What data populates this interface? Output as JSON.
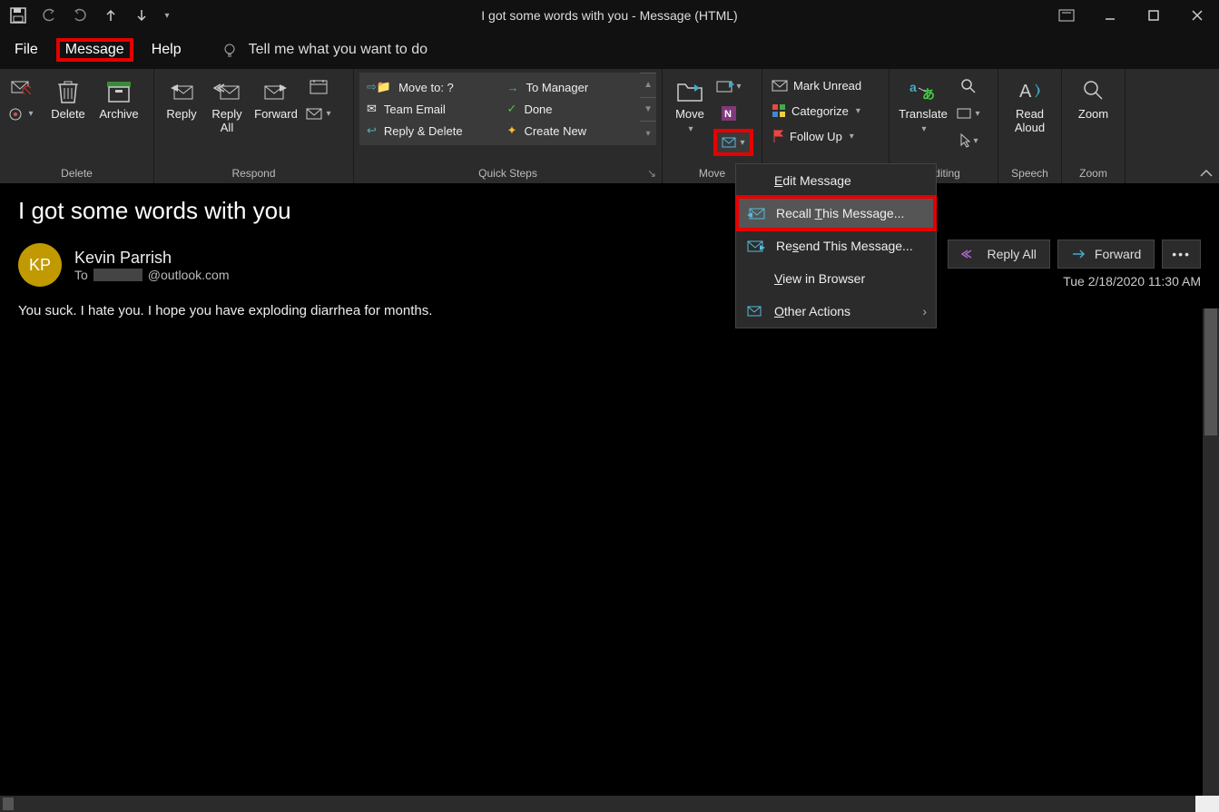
{
  "window": {
    "title": "I got some words with you  -  Message (HTML)"
  },
  "tabs": {
    "file": "File",
    "message": "Message",
    "help": "Help",
    "tellme": "Tell me what you want to do"
  },
  "ribbon": {
    "delete": {
      "label": "Delete",
      "group": "Delete",
      "archive": "Archive"
    },
    "respond": {
      "reply": "Reply",
      "replyall": "Reply All",
      "replyall2": "All",
      "forward": "Forward",
      "group": "Respond"
    },
    "quicksteps": {
      "group": "Quick Steps",
      "items": [
        "Move to: ?",
        "Team Email",
        "Reply & Delete",
        "To Manager",
        "Done",
        "Create New"
      ]
    },
    "move": {
      "label": "Move",
      "group": "Move"
    },
    "tags": {
      "unread": "Mark Unread",
      "categorize": "Categorize",
      "followup": "Follow Up"
    },
    "editing": {
      "translate": "Translate",
      "group": "Editing"
    },
    "speech": {
      "read": "Read",
      "aloud": "Aloud",
      "group": "Speech"
    },
    "zoom": {
      "label": "Zoom",
      "group": "Zoom"
    }
  },
  "menu": {
    "edit": "Edit Message",
    "recall": "Recall This Message...",
    "resend": "Resend This Message...",
    "view": "View in Browser",
    "other": "Other Actions"
  },
  "message": {
    "subject": "I got some words with you",
    "avatar": "KP",
    "sender": "Kevin Parrish",
    "to_label": "To",
    "to_domain": "@outlook.com",
    "timestamp": "Tue 2/18/2020 11:30 AM",
    "body": "You suck. I hate you. I hope you have exploding diarrhea for months."
  },
  "actions": {
    "replyall": "Reply All",
    "forward": "Forward"
  }
}
